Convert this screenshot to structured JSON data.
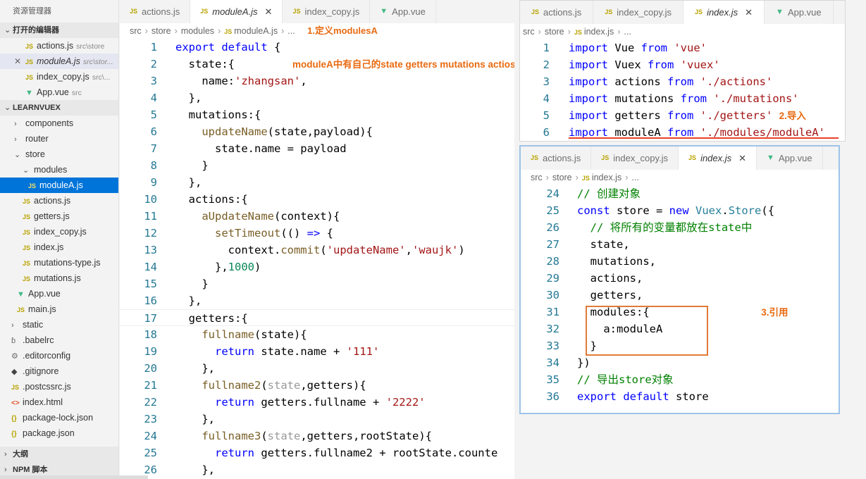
{
  "sidebar": {
    "title": "资源管理器",
    "open_editors_label": "打开的编辑器",
    "open_editors": [
      {
        "name": "actions.js",
        "hint": "src\\store"
      },
      {
        "name": "moduleA.js",
        "hint": "src\\stor..."
      },
      {
        "name": "index_copy.js",
        "hint": "src\\..."
      },
      {
        "name": "App.vue",
        "hint": "src"
      }
    ],
    "project_label": "LEARNVUEX",
    "tree": [
      {
        "name": "components",
        "type": "folder"
      },
      {
        "name": "router",
        "type": "folder"
      },
      {
        "name": "store",
        "type": "folder"
      },
      {
        "name": "modules",
        "type": "folder"
      },
      {
        "name": "moduleA.js",
        "type": "js"
      },
      {
        "name": "actions.js",
        "type": "js"
      },
      {
        "name": "getters.js",
        "type": "js"
      },
      {
        "name": "index_copy.js",
        "type": "js"
      },
      {
        "name": "index.js",
        "type": "js"
      },
      {
        "name": "mutations-type.js",
        "type": "js"
      },
      {
        "name": "mutations.js",
        "type": "js"
      },
      {
        "name": "App.vue",
        "type": "vue"
      },
      {
        "name": "main.js",
        "type": "js"
      },
      {
        "name": "static",
        "type": "folder"
      },
      {
        "name": ".babelrc",
        "type": "babel"
      },
      {
        "name": ".editorconfig",
        "type": "gear"
      },
      {
        "name": ".gitignore",
        "type": "git"
      },
      {
        "name": ".postcssrc.js",
        "type": "js"
      },
      {
        "name": "index.html",
        "type": "html"
      },
      {
        "name": "package-lock.json",
        "type": "json"
      },
      {
        "name": "package.json",
        "type": "json"
      }
    ],
    "outline_label": "大纲",
    "npm_label": "NPM 脚本"
  },
  "main_editor": {
    "tabs": [
      "actions.js",
      "moduleA.js",
      "index_copy.js",
      "App.vue"
    ],
    "breadcrumb": [
      "src",
      "store",
      "modules",
      "moduleA.js",
      "..."
    ],
    "note1": "1.定义modulesA",
    "note_inline": "moduleA中有自己的state getters mutations actios"
  },
  "right_top": {
    "tabs": [
      "actions.js",
      "index_copy.js",
      "index.js",
      "App.vue"
    ],
    "breadcrumb": [
      "src",
      "store",
      "index.js",
      "..."
    ],
    "note2": "2.导入"
  },
  "right_bottom": {
    "tabs": [
      "actions.js",
      "index_copy.js",
      "index.js",
      "App.vue"
    ],
    "breadcrumb": [
      "src",
      "store",
      "index.js",
      "..."
    ],
    "note3": "3.引用"
  }
}
